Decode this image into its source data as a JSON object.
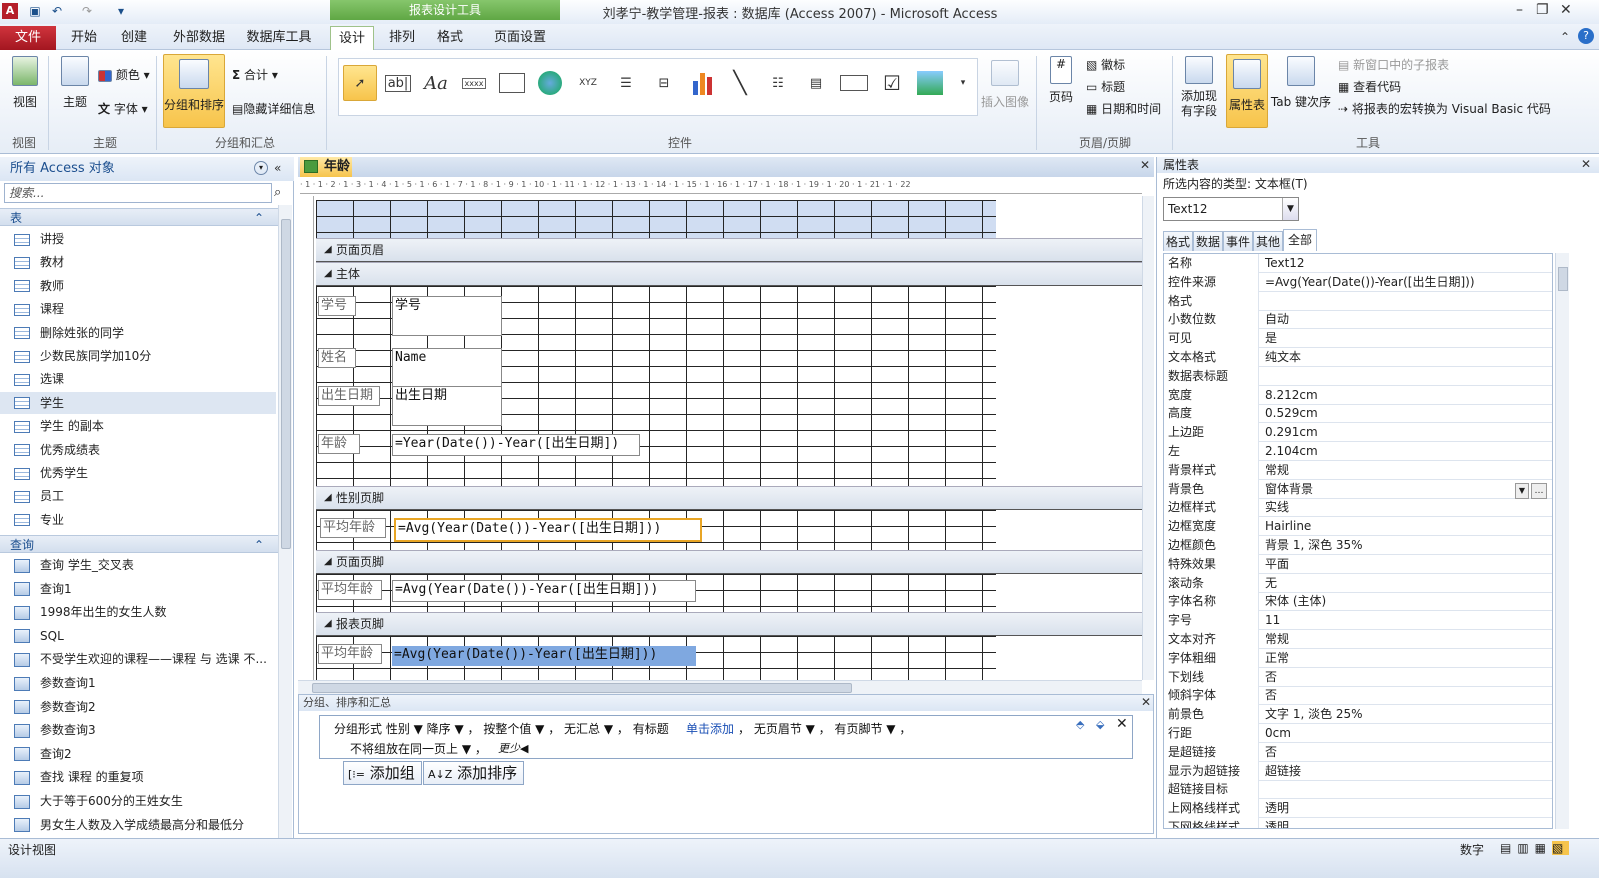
{
  "app": {
    "window_title": "刘孝宁-教学管理-报表 : 数据库 (Access 2007)  -  Microsoft Access",
    "context_label": "报表设计工具"
  },
  "ribbon_tabs": [
    "文件",
    "开始",
    "创建",
    "外部数据",
    "数据库工具",
    "设计",
    "排列",
    "格式",
    "页面设置"
  ],
  "ribbon": {
    "view": {
      "label": "视图",
      "group": "视图"
    },
    "theme": {
      "theme": "主题",
      "colors": "颜色",
      "fonts": "字体",
      "group": "主题"
    },
    "grouping": {
      "group_sort": "分组和排序",
      "totals": "合计",
      "hide_details": "隐藏详细信息",
      "group": "分组和汇总"
    },
    "controls": {
      "group": "控件",
      "insert_image": "插入图像"
    },
    "header_footer": {
      "page_numbers": "页码",
      "logo": "徽标",
      "title": "标题",
      "date_time": "日期和时间",
      "group": "页眉/页脚"
    },
    "tools": {
      "add_fields": "添加现有字段",
      "property_sheet": "属性表",
      "tab_order": "Tab 键次序",
      "subreport": "新窗口中的子报表",
      "view_code": "查看代码",
      "convert_vba": "将报表的宏转换为 Visual Basic 代码",
      "group": "工具"
    }
  },
  "nav": {
    "header": "所有 Access 对象",
    "search_placeholder": "搜索...",
    "tables_header": "表",
    "tables": [
      "讲授",
      "教材",
      "教师",
      "课程",
      "删除姓张的同学",
      "少数民族同学加10分",
      "选课",
      "学生",
      "学生 的副本",
      "优秀成绩表",
      "优秀学生",
      "员工",
      "专业"
    ],
    "queries_header": "查询",
    "queries": [
      "查询 学生_交叉表",
      "查询1",
      "1998年出生的女生人数",
      "SQL",
      "不受学生欢迎的课程——课程 与 选课 不...",
      "参数查询1",
      "参数查询2",
      "参数查询3",
      "查询2",
      "查找 课程 的重复项",
      "大于等于600分的王姓女生",
      "男女生人数及入学成绩最高分和最低分"
    ]
  },
  "document": {
    "tab_label": "年龄",
    "ruler_text": "· 1 · 1 · 2 · 1 · 3 · 1 · 4 · 1 · 5 · 1 · 6 · 1 · 7 · 1 · 8 · 1 · 9 · 1 · 10 · 1 · 11 · 1 · 12 · 1 · 13 · 1 · 14 · 1 · 15 · 1 · 16 · 1 · 17 · 1 · 18 · 1 · 19 · 1 · 20 · 1 · 21 · 1 · 22",
    "bands": {
      "page_header": "页面页眉",
      "detail": "主体",
      "gender_footer": "性别页脚",
      "page_footer": "页面页脚",
      "report_footer": "报表页脚"
    },
    "detail": {
      "id_label": "学号",
      "id_value": "学号",
      "name_label": "姓名",
      "name_value": "Name",
      "birth_label": "出生日期",
      "birth_value": "出生日期",
      "age_label": "年龄",
      "age_value": "=Year(Date())-Year([出生日期])"
    },
    "gender_footer": {
      "label": "平均年龄",
      "value": "=Avg(Year(Date())-Year([出生日期]))"
    },
    "page_footer": {
      "label": "平均年龄",
      "value": "=Avg(Year(Date())-Year([出生日期]))"
    },
    "report_footer": {
      "label": "平均年龄",
      "value": "=Avg(Year(Date())-Year([出生日期]))"
    }
  },
  "grouping_pane": {
    "header": "分组、排序和汇总",
    "group_by": "分组形式 性别 ▼ 降序 ▼ ， 按整个值 ▼ ， 无汇总 ▼ ， 有标题",
    "click_add": "单击添加",
    "after_add": "， 无页眉节 ▼ ， 有页脚节 ▼ ，",
    "keep": "不将组放在同一页上 ▼ ，",
    "less": "更少◀",
    "add_group": "添加组",
    "add_sort": "添加排序"
  },
  "property_sheet": {
    "title": "属性表",
    "selection_type": "所选内容的类型: 文本框(T)",
    "selected": "Text12",
    "tabs": [
      "格式",
      "数据",
      "事件",
      "其他",
      "全部"
    ],
    "rows": [
      [
        "名称",
        "Text12"
      ],
      [
        "控件来源",
        "=Avg(Year(Date())-Year([出生日期]))"
      ],
      [
        "格式",
        ""
      ],
      [
        "小数位数",
        "自动"
      ],
      [
        "可见",
        "是"
      ],
      [
        "文本格式",
        "纯文本"
      ],
      [
        "数据表标题",
        ""
      ],
      [
        "宽度",
        "8.212cm"
      ],
      [
        "高度",
        "0.529cm"
      ],
      [
        "上边距",
        "0.291cm"
      ],
      [
        "左",
        "2.104cm"
      ],
      [
        "背景样式",
        "常规"
      ],
      [
        "背景色",
        "窗体背景"
      ],
      [
        "边框样式",
        "实线"
      ],
      [
        "边框宽度",
        "Hairline"
      ],
      [
        "边框颜色",
        "背景 1, 深色 35%"
      ],
      [
        "特殊效果",
        "平面"
      ],
      [
        "滚动条",
        "无"
      ],
      [
        "字体名称",
        "宋体 (主体)"
      ],
      [
        "字号",
        "11"
      ],
      [
        "文本对齐",
        "常规"
      ],
      [
        "字体粗细",
        "正常"
      ],
      [
        "下划线",
        "否"
      ],
      [
        "倾斜字体",
        "否"
      ],
      [
        "前景色",
        "文字 1, 淡色 25%"
      ],
      [
        "行距",
        "0cm"
      ],
      [
        "是超链接",
        "否"
      ],
      [
        "显示为超链接",
        "超链接"
      ],
      [
        "超链接目标",
        ""
      ],
      [
        "上网格线样式",
        "透明"
      ],
      [
        "下网格线样式",
        "透明"
      ]
    ]
  },
  "status": {
    "left": "设计视图",
    "right": "数字"
  },
  "colors": {
    "accent": "#f6c44c",
    "file_tab": "#b51f2a",
    "context": "#6fb455",
    "selection": "#e8a525"
  }
}
